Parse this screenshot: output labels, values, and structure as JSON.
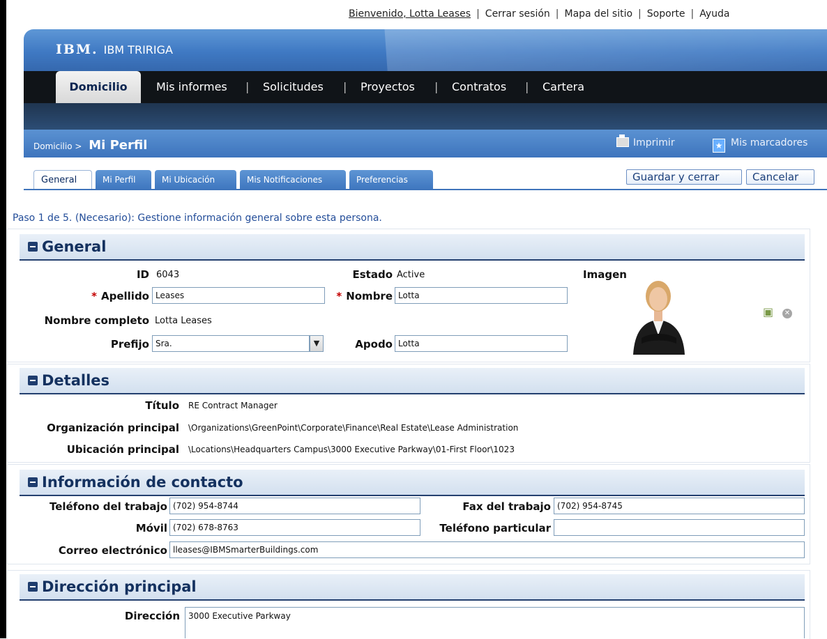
{
  "util_links": {
    "welcome": "Bienvenido, Lotta Leases",
    "logout": "Cerrar sesión",
    "sitemap": "Mapa del sitio",
    "support": "Soporte",
    "help": "Ayuda"
  },
  "brand": {
    "ibm": "IBM.",
    "product": "IBM TRIRIGA"
  },
  "nav": {
    "active": "Domicilio",
    "items": [
      "Mis informes",
      "Solicitudes",
      "Proyectos",
      "Contratos",
      "Cartera"
    ]
  },
  "titlebar": {
    "crumb": "Domicilio",
    "arrow": ">",
    "page_title": "Mi Perfil",
    "print": "Imprimir",
    "bookmarks": "Mis marcadores"
  },
  "tabs": [
    "General",
    "Mi Perfil",
    "Mi Ubicación",
    "Mis Notificaciones",
    "Preferencias"
  ],
  "buttons": {
    "save_close": "Guardar y cerrar",
    "cancel": "Cancelar"
  },
  "step_text": "Paso 1 de 5. (Necesario): Gestione información general sobre esta persona.",
  "general": {
    "header": "General",
    "id_label": "ID",
    "id_value": "6043",
    "status_label": "Estado",
    "status_value": "Active",
    "image_label": "Imagen",
    "lastname_label": "Apellido",
    "lastname_value": "Leases",
    "firstname_label": "Nombre",
    "firstname_value": "Lotta",
    "fullname_label": "Nombre completo",
    "fullname_value": "Lotta Leases",
    "prefix_label": "Prefijo",
    "prefix_value": "Sra.",
    "nickname_label": "Apodo",
    "nickname_value": "Lotta",
    "required_mark": "*"
  },
  "details": {
    "header": "Detalles",
    "title_label": "Título",
    "title_value": "RE Contract Manager",
    "org_label": "Organización principal",
    "org_value": "\\Organizations\\GreenPoint\\Corporate\\Finance\\Real Estate\\Lease Administration",
    "location_label": "Ubicación principal",
    "location_value": "\\Locations\\Headquarters Campus\\3000 Executive Parkway\\01-First Floor\\1023"
  },
  "contact": {
    "header": "Información de contacto",
    "work_phone_label": "Teléfono del trabajo",
    "work_phone_value": "(702) 954-8744",
    "work_fax_label": "Fax del trabajo",
    "work_fax_value": "(702) 954-8745",
    "mobile_label": "Móvil",
    "mobile_value": "(702) 678-8763",
    "home_phone_label": "Teléfono particular",
    "home_phone_value": "",
    "email_label": "Correo electrónico",
    "email_value": "lleases@IBMSmarterBuildings.com"
  },
  "address": {
    "header": "Dirección principal",
    "address_label": "Dirección",
    "address_value": "3000 Executive Parkway"
  },
  "colors": {
    "accent": "#3f79c3",
    "nav_bg": "#101418",
    "section_border": "#24406f",
    "required": "#c40000"
  }
}
